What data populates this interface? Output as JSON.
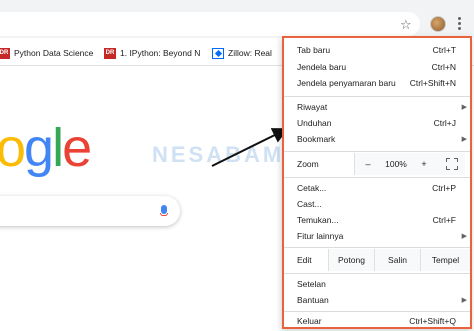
{
  "bookmarks": [
    {
      "label": "Python Data Science",
      "favicon": "DR"
    },
    {
      "label": "1. IPython: Beyond N",
      "favicon": "DR"
    },
    {
      "label": "Zillow: Real",
      "favicon": "zillow"
    }
  ],
  "watermark": "NESABAMEDIA",
  "logo_text": "ogle",
  "colors": {
    "menu_outline": "#e8623e",
    "google_blue": "#4285f4",
    "google_red": "#ea4335",
    "google_yellow": "#fbbc05",
    "google_green": "#34a853"
  },
  "menu": {
    "new_tab": {
      "label": "Tab baru",
      "shortcut": "Ctrl+T"
    },
    "new_window": {
      "label": "Jendela baru",
      "shortcut": "Ctrl+N"
    },
    "incognito": {
      "label": "Jendela penyamaran baru",
      "shortcut": "Ctrl+Shift+N"
    },
    "history": {
      "label": "Riwayat"
    },
    "downloads": {
      "label": "Unduhan",
      "shortcut": "Ctrl+J"
    },
    "bookmarks": {
      "label": "Bookmark"
    },
    "zoom": {
      "label": "Zoom",
      "minus": "–",
      "value": "100%",
      "plus": "+"
    },
    "print": {
      "label": "Cetak...",
      "shortcut": "Ctrl+P"
    },
    "cast": {
      "label": "Cast..."
    },
    "find": {
      "label": "Temukan...",
      "shortcut": "Ctrl+F"
    },
    "more_tools": {
      "label": "Fitur lainnya"
    },
    "edit": {
      "label": "Edit",
      "cut": "Potong",
      "copy": "Salin",
      "paste": "Tempel"
    },
    "settings": {
      "label": "Setelan"
    },
    "help": {
      "label": "Bantuan"
    },
    "exit": {
      "label": "Keluar",
      "shortcut": "Ctrl+Shift+Q"
    }
  }
}
